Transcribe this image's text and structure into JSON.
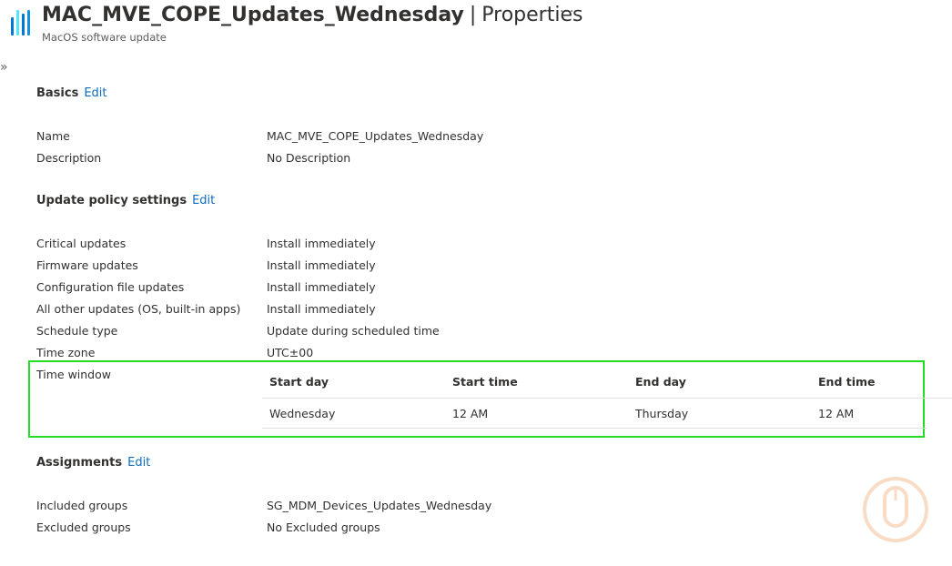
{
  "header": {
    "title": "MAC_MVE_COPE_Updates_Wednesday",
    "separator": "|",
    "section": "Properties",
    "subtitle": "MacOS software update",
    "more": "···"
  },
  "expand": "»",
  "edit_label": "Edit",
  "basics": {
    "title": "Basics",
    "rows": [
      {
        "label": "Name",
        "value": "MAC_MVE_COPE_Updates_Wednesday"
      },
      {
        "label": "Description",
        "value": "No Description"
      }
    ]
  },
  "update_policy": {
    "title": "Update policy settings",
    "rows": [
      {
        "label": "Critical updates",
        "value": "Install immediately"
      },
      {
        "label": "Firmware updates",
        "value": "Install immediately"
      },
      {
        "label": "Configuration file updates",
        "value": "Install immediately"
      },
      {
        "label": "All other updates (OS, built-in apps)",
        "value": "Install immediately"
      },
      {
        "label": "Schedule type",
        "value": "Update during scheduled time"
      },
      {
        "label": "Time zone",
        "value": "UTC±00"
      }
    ],
    "time_window": {
      "label": "Time window",
      "columns": [
        "Start day",
        "Start time",
        "End day",
        "End time"
      ],
      "rows": [
        [
          "Wednesday",
          "12 AM",
          "Thursday",
          "12 AM"
        ]
      ]
    }
  },
  "assignments": {
    "title": "Assignments",
    "rows": [
      {
        "label": "Included groups",
        "value": "SG_MDM_Devices_Updates_Wednesday"
      },
      {
        "label": "Excluded groups",
        "value": "No Excluded groups"
      }
    ]
  },
  "colors": {
    "link": "#0f6cbd",
    "highlight": "#22dd22",
    "icon_blue": "#0078d4",
    "icon_light": "#50e6ff"
  },
  "icons": {
    "app": "intune-bars-icon",
    "more": "ellipsis-icon",
    "expand": "double-chevron-right-icon",
    "watermark": "mouse-watermark-icon"
  }
}
